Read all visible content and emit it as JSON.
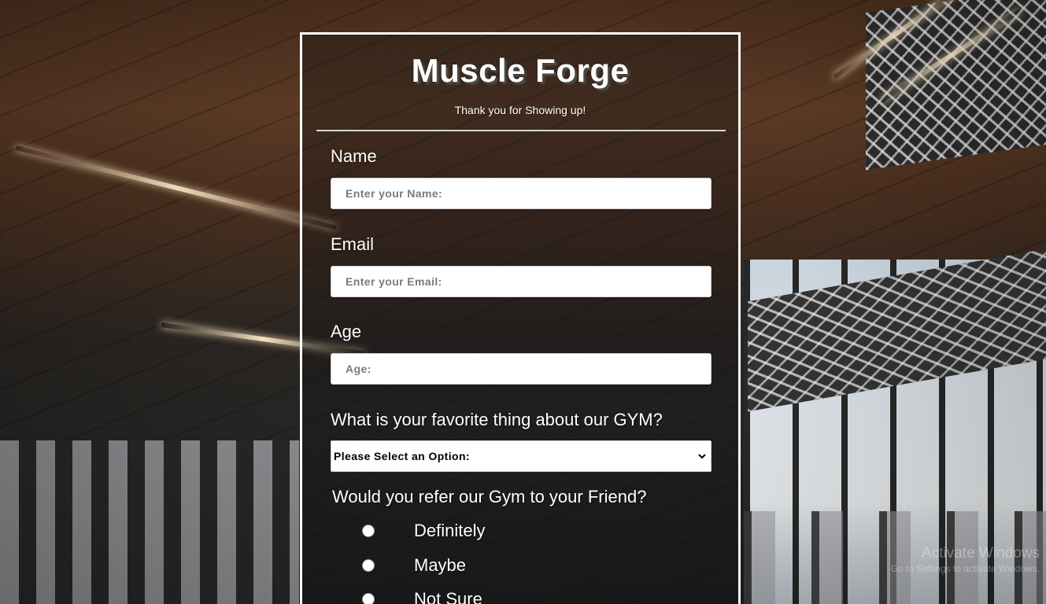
{
  "page": {
    "background_description_colors": {
      "wood": "#5b3a25",
      "wall": "#262624",
      "window": "#dfe5ea"
    }
  },
  "watermark": {
    "title": "Activate Windows",
    "subtitle": "Go to Settings to activate Windows."
  },
  "form": {
    "title": "Muscle Forge",
    "subtitle": "Thank you for Showing up!",
    "name": {
      "label": "Name",
      "placeholder": "Enter your Name:",
      "value": ""
    },
    "email": {
      "label": "Email",
      "placeholder": "Enter your Email:",
      "value": ""
    },
    "age": {
      "label": "Age",
      "placeholder": "Age:",
      "value": ""
    },
    "favorite": {
      "label": "What is your favorite thing about our GYM?",
      "selected": "Please Select an Option:",
      "icon": "chevron-down-icon"
    },
    "refer": {
      "label": "Would you refer our Gym to your Friend?",
      "options": [
        "Definitely",
        "Maybe",
        "Not Sure"
      ]
    },
    "colors": {
      "border": "#ffffff",
      "text": "#ffffff",
      "input_bg": "#ffffff"
    }
  }
}
